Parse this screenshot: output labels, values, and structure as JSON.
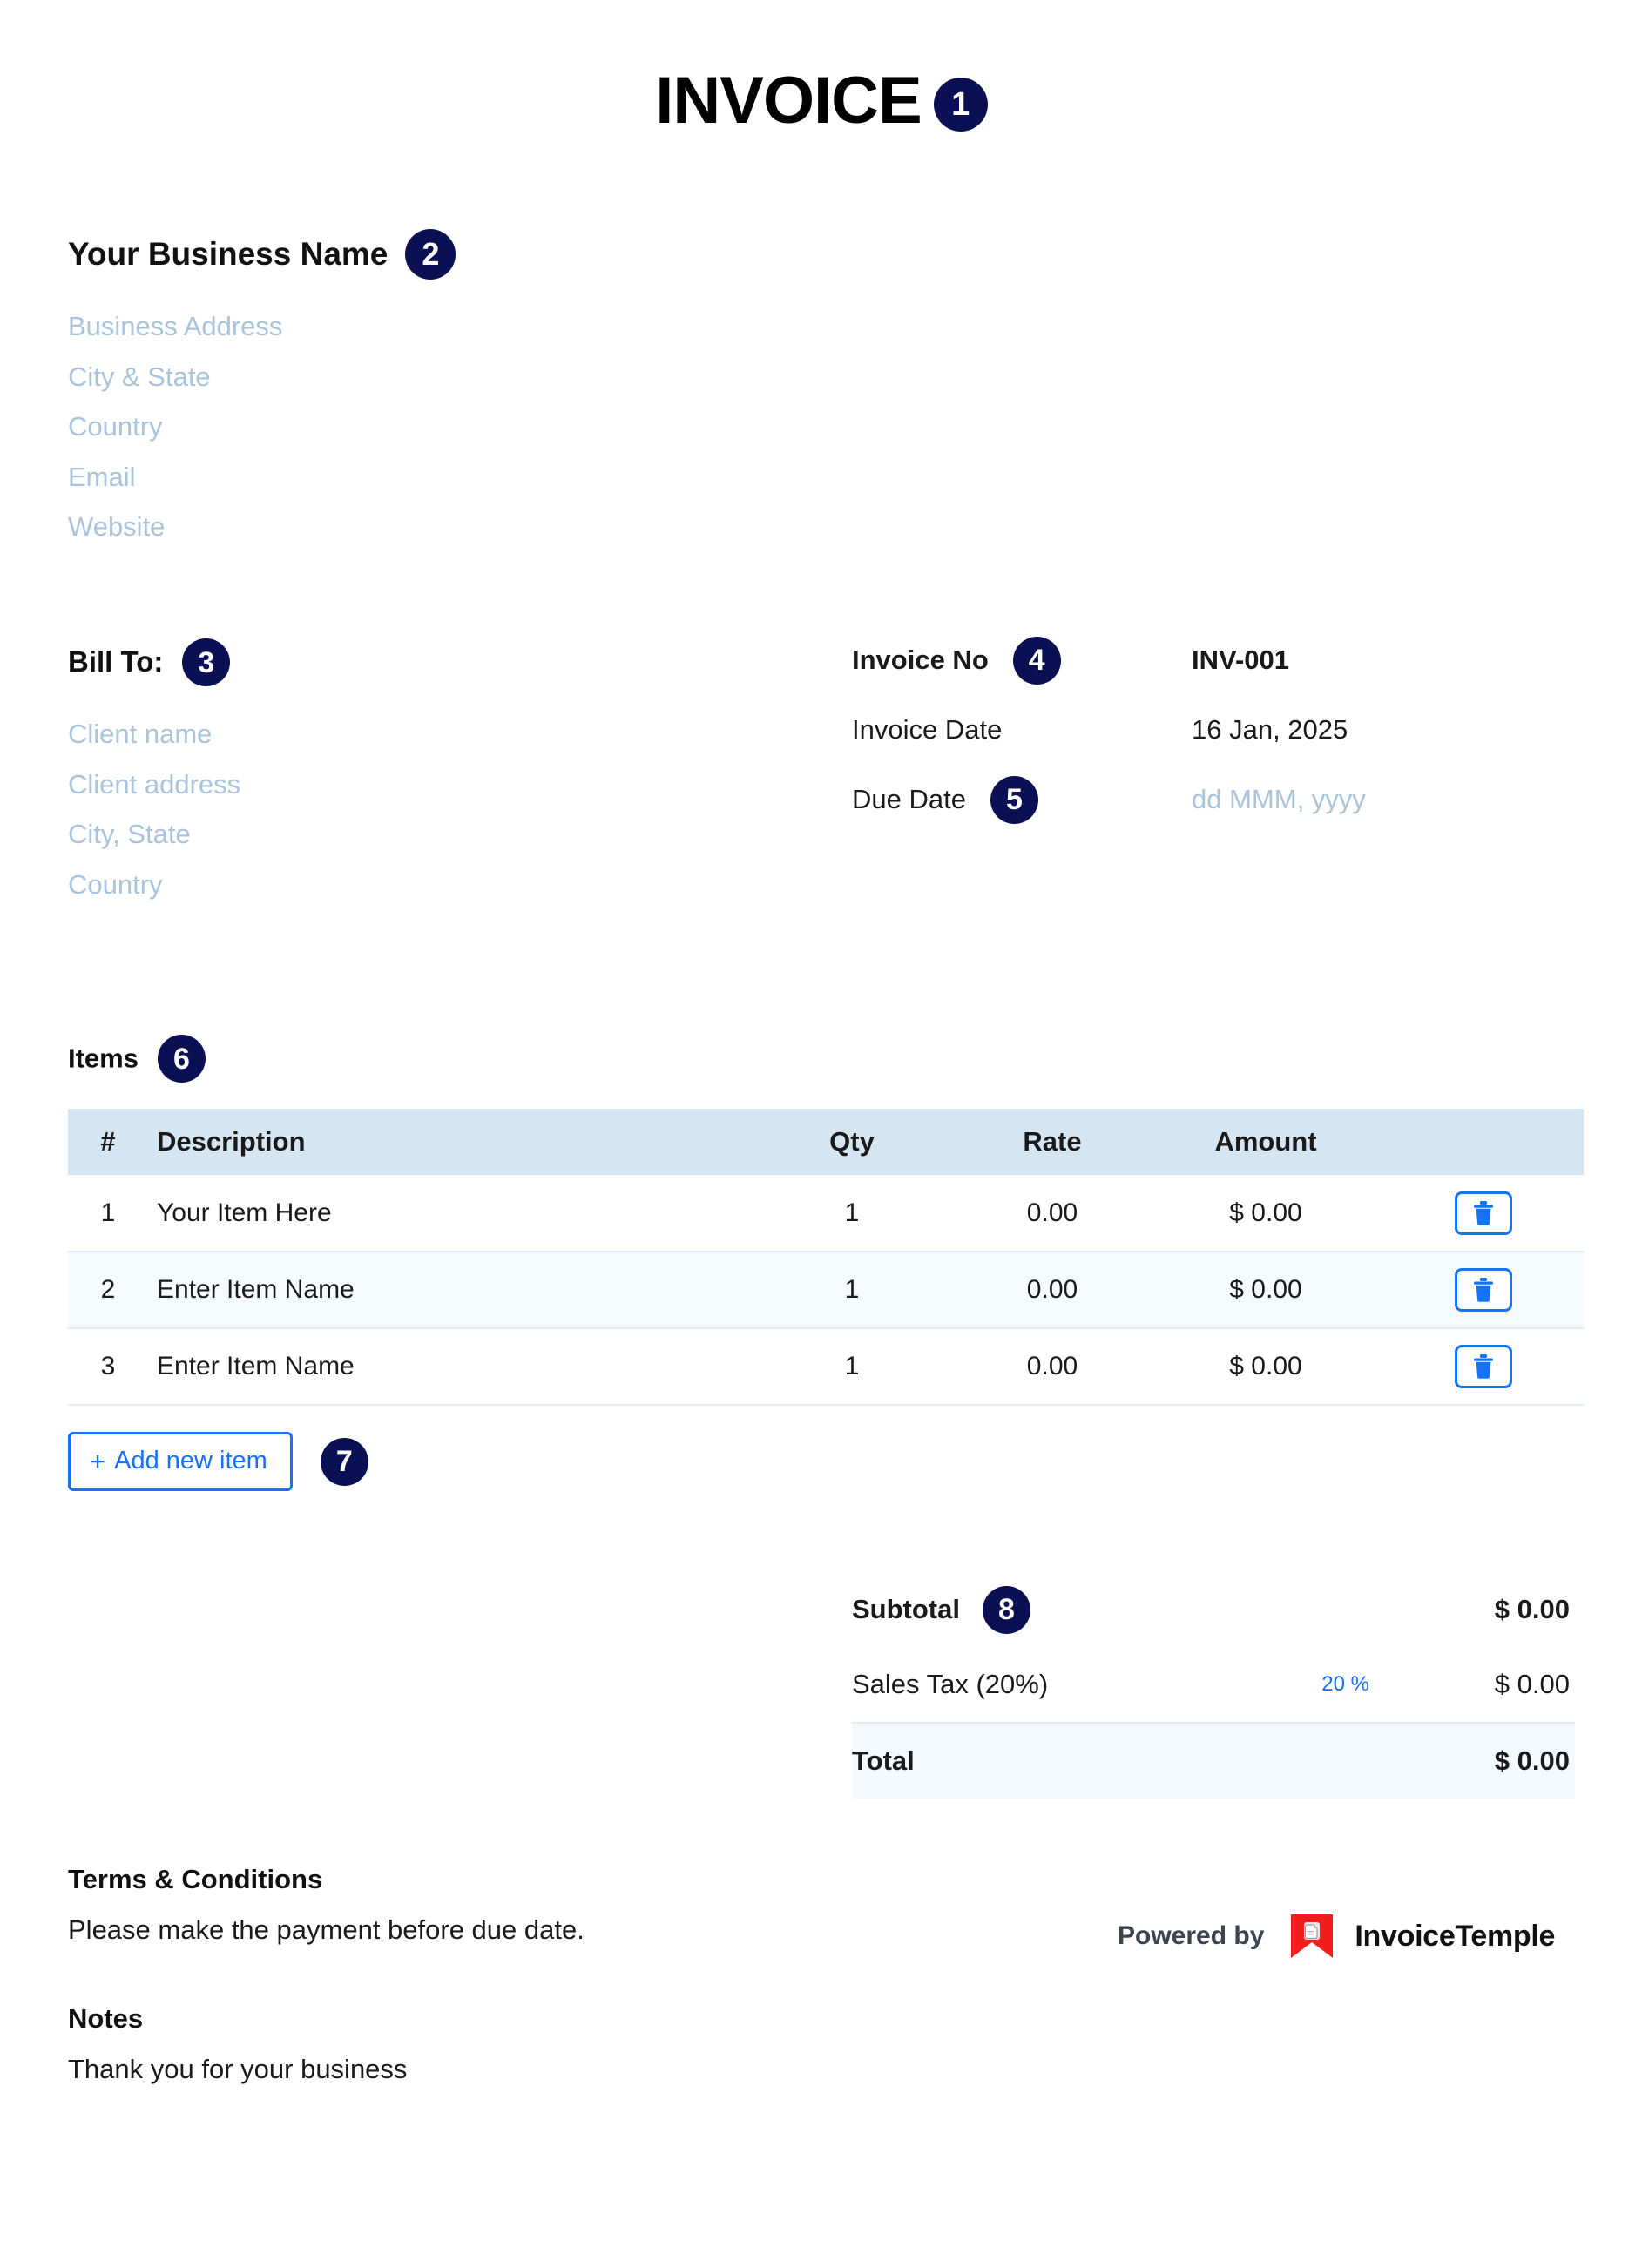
{
  "document": {
    "title": "INVOICE",
    "title_badge": "1"
  },
  "business": {
    "name": "Your Business Name",
    "badge": "2",
    "lines": [
      "Business Address",
      "City & State",
      "Country",
      "Email",
      "Website"
    ]
  },
  "bill_to": {
    "heading": "Bill To:",
    "badge": "3",
    "lines": [
      "Client name",
      "Client address",
      "City, State",
      "Country"
    ]
  },
  "meta": {
    "invoice_no": {
      "label": "Invoice No",
      "badge": "4",
      "value": "INV-001"
    },
    "invoice_date": {
      "label": "Invoice Date",
      "value": "16 Jan, 2025"
    },
    "due_date": {
      "label": "Due Date",
      "badge": "5",
      "value": "dd MMM, yyyy"
    }
  },
  "items": {
    "section_label": "Items",
    "badge": "6",
    "columns": {
      "num": "#",
      "description": "Description",
      "qty": "Qty",
      "rate": "Rate",
      "amount": "Amount"
    },
    "rows": [
      {
        "num": "1",
        "description": "Your Item Here",
        "qty": "1",
        "rate": "0.00",
        "amount": "$ 0.00",
        "filled": true
      },
      {
        "num": "2",
        "description": "Enter Item Name",
        "qty": "1",
        "rate": "0.00",
        "amount": "$ 0.00",
        "filled": false
      },
      {
        "num": "3",
        "description": "Enter Item Name",
        "qty": "1",
        "rate": "0.00",
        "amount": "$ 0.00",
        "filled": false
      }
    ],
    "delete_icon": "trash-icon",
    "add_button": {
      "plus": "+",
      "label": "Add new item",
      "badge": "7"
    }
  },
  "totals": {
    "subtotal": {
      "label": "Subtotal",
      "badge": "8",
      "value": "$ 0.00"
    },
    "sales_tax": {
      "label": "Sales Tax (20%)",
      "rate": "20 %",
      "value": "$ 0.00"
    },
    "total": {
      "label": "Total",
      "value": "$ 0.00"
    }
  },
  "footer": {
    "terms_heading": "Terms & Conditions",
    "terms_text": "Please make the payment before due date.",
    "notes_heading": "Notes",
    "notes_text": "Thank you for your business",
    "powered_by": "Powered by",
    "brand": "InvoiceTemple"
  },
  "colors": {
    "badge": "#0b1054",
    "accent_blue": "#1673f5",
    "placeholder": "#a9c4dc",
    "table_header": "#d6e5f2",
    "row_alt": "#f5fafd",
    "logo_red": "#f21d1d"
  }
}
